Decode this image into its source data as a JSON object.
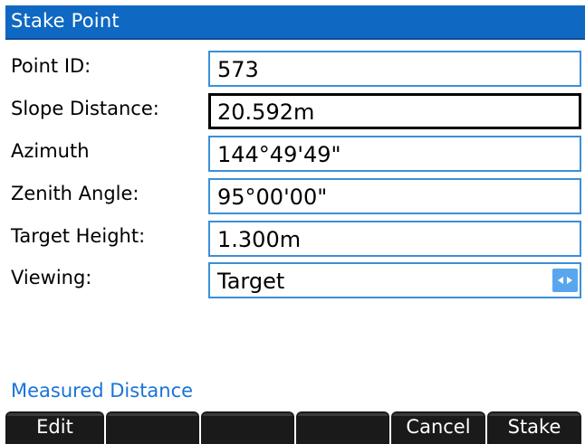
{
  "window": {
    "title": "Stake Point"
  },
  "form": {
    "rows": [
      {
        "label": "Point ID:",
        "value": "573"
      },
      {
        "label": "Slope Distance:",
        "value": "20.592m"
      },
      {
        "label": "Azimuth",
        "value": "144°49'49\""
      },
      {
        "label": "Zenith Angle:",
        "value": "95°00'00\""
      },
      {
        "label": "Target Height:",
        "value": "1.300m"
      },
      {
        "label": "Viewing:",
        "value": "Target",
        "icon": "left-right-arrows-icon"
      }
    ]
  },
  "status": {
    "measured_label": "Measured Distance"
  },
  "softkeys": [
    {
      "label": "Edit"
    },
    {
      "label": ""
    },
    {
      "label": ""
    },
    {
      "label": ""
    },
    {
      "label": "Cancel"
    },
    {
      "label": "Stake"
    }
  ],
  "colors": {
    "titlebar": "#0f68c2",
    "field_border": "#3a8fd9",
    "focused_border": "#000000",
    "link_text": "#1a73d6",
    "softkey_bg": "#1a1a1a",
    "chooser_button": "#5aa6ee"
  }
}
